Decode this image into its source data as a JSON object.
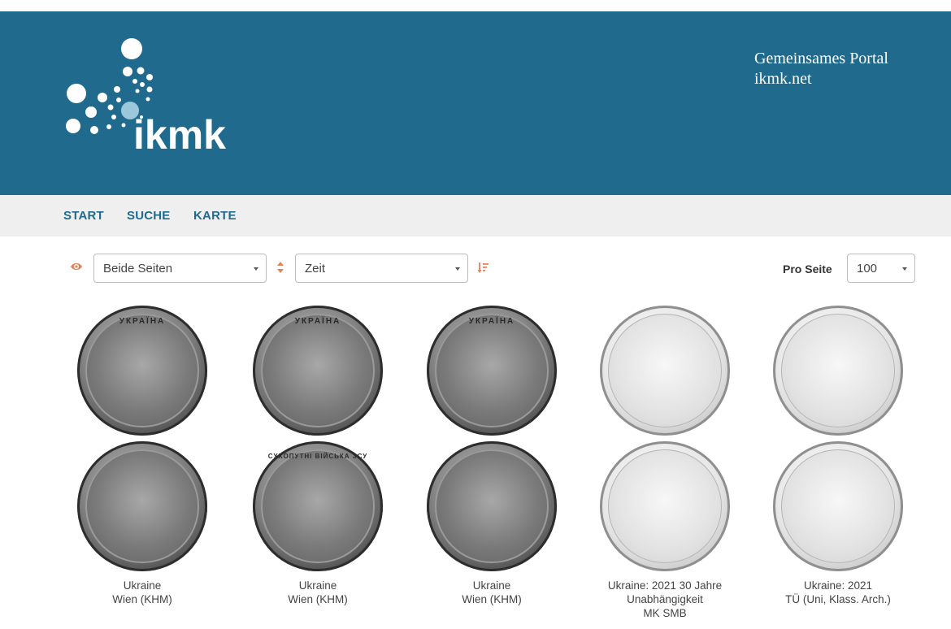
{
  "header": {
    "logo_text": "ikmk",
    "portal_line1": "Gemeinsames Portal",
    "portal_line2": "ikmk.net"
  },
  "nav": {
    "items": [
      {
        "label": "START"
      },
      {
        "label": "SUCHE"
      },
      {
        "label": "KARTE"
      }
    ]
  },
  "controls": {
    "view_icon": "eye-icon",
    "view_select": "Beide Seiten",
    "sort_direction_icon": "sort-icon",
    "sort_select": "Zeit",
    "sort_order_icon": "sort-descending-icon",
    "per_page_label": "Pro Seite",
    "per_page_select": "100"
  },
  "colors": {
    "header_bg": "#1f6a8d",
    "nav_bg": "#efefef",
    "nav_link": "#1f6a8d",
    "accent_icon": "#e0835f"
  },
  "coins": [
    {
      "obverse_text": "УКРАЇНА",
      "reverse_text": "",
      "caption_lines": [
        "Ukraine",
        "Wien (KHM)"
      ],
      "finish": "dark"
    },
    {
      "obverse_text": "УКРАЇНА",
      "reverse_text": "СУХОПУТНІ ВІЙСЬКА ЗСУ",
      "caption_lines": [
        "Ukraine",
        "Wien (KHM)"
      ],
      "finish": "dark"
    },
    {
      "obverse_text": "УКРАЇНА",
      "reverse_text": "",
      "caption_lines": [
        "Ukraine",
        "Wien (KHM)"
      ],
      "finish": "dark"
    },
    {
      "obverse_text": "",
      "reverse_text": "",
      "caption_lines": [
        "Ukraine: 2021 30 Jahre",
        "Unabhängigkeit",
        "MK SMB"
      ],
      "finish": "light"
    },
    {
      "obverse_text": "",
      "reverse_text": "",
      "caption_lines": [
        "Ukraine: 2021",
        "TÜ (Uni, Klass. Arch.)"
      ],
      "finish": "light"
    }
  ]
}
